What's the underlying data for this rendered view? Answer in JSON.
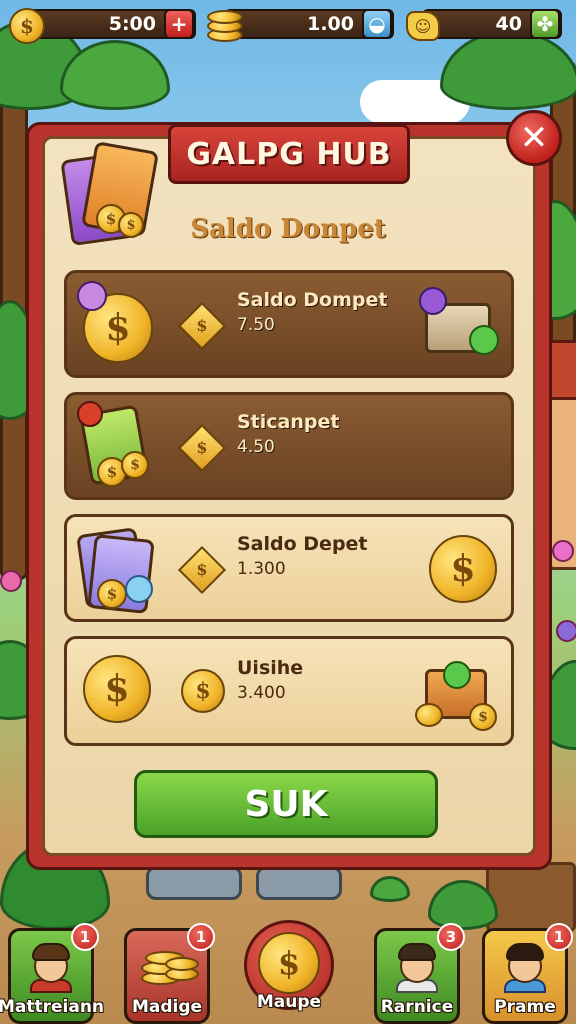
{
  "top_bar": {
    "resources": [
      {
        "icon": "gold-coin-icon",
        "value": "5:00",
        "button_icon": "plus-icon",
        "button_glyph": "+"
      },
      {
        "icon": "coin-stack-icon",
        "value": "1.00",
        "button_icon": "bubble-icon",
        "button_glyph": "◒"
      },
      {
        "icon": "smiley-badge-icon",
        "value": "40",
        "button_icon": "clover-icon",
        "button_glyph": "✤"
      }
    ]
  },
  "panel": {
    "title": "GALPG HUB",
    "subtitle": "Saldo Donpet",
    "close_glyph": "✕",
    "rows": [
      {
        "name": "Saldo Dompet",
        "value": "7.50",
        "style": "dark",
        "left_icon": "coin-with-badge-icon",
        "right_icon": "treasure-chest-icon"
      },
      {
        "name": "Sticanpet",
        "value": "4.50",
        "style": "dark",
        "left_icon": "green-cards-icon",
        "right_icon": ""
      },
      {
        "name": "Saldo Depet",
        "value": "1.300",
        "style": "light",
        "left_icon": "purple-cards-icon",
        "right_icon": "gold-coin-icon"
      },
      {
        "name": "Uisihe",
        "value": "3.400",
        "style": "light",
        "left_icon": "gold-coin-icon",
        "right_icon": "gift-box-icon"
      }
    ],
    "coin_glyph": "$",
    "button_label": "SUK"
  },
  "bottom_nav": {
    "items": [
      {
        "label": "Mattreiann",
        "badge": "1",
        "color": "green"
      },
      {
        "label": "Madige",
        "badge": "1",
        "color": "red"
      },
      {
        "label": "Maupe",
        "badge": "",
        "color": "red"
      },
      {
        "label": "Rarnice",
        "badge": "3",
        "color": "green"
      },
      {
        "label": "Prame",
        "badge": "1",
        "color": "yellow"
      }
    ]
  },
  "colors": {
    "panel_frame": "#b8342c",
    "panel_bg": "#f3e2bf",
    "row_dark": "#7a4e2a",
    "row_light": "#f2dcaa",
    "action_button": "#5fb832",
    "coin_gold": "#f0b428"
  }
}
